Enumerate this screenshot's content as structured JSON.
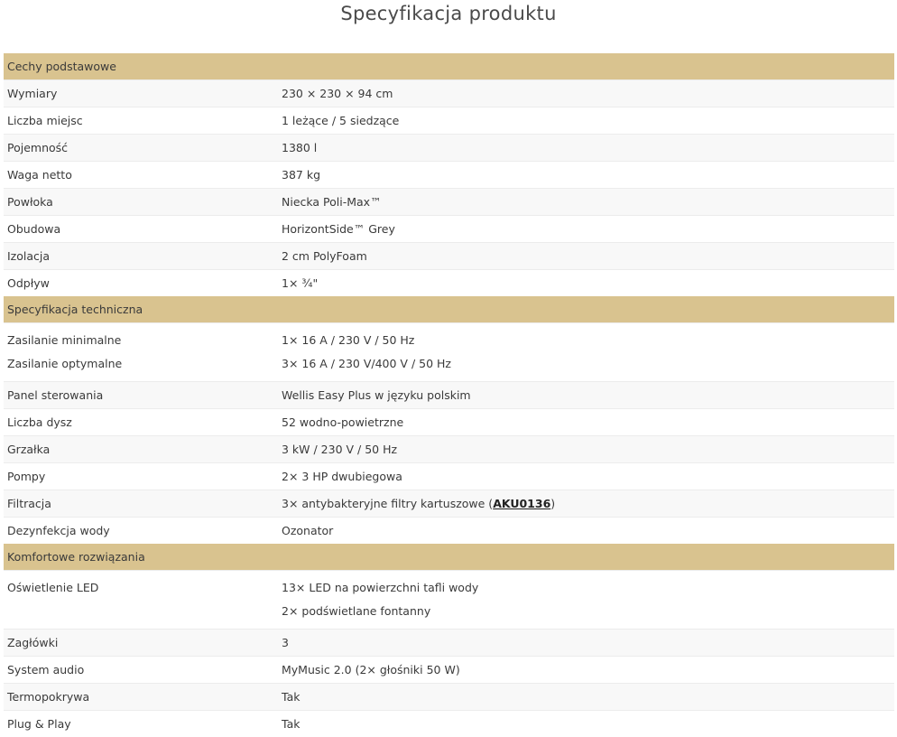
{
  "page_title": "Specyfikacja produktu",
  "sections": [
    {
      "title": "Cechy podstawowe",
      "rows": [
        {
          "label": "Wymiary",
          "value": "230 × 230 × 94 cm"
        },
        {
          "label": "Liczba miejsc",
          "value": "1 leżące / 5 siedzące"
        },
        {
          "label": "Pojemność",
          "value": "1380 l"
        },
        {
          "label": "Waga netto",
          "value": "387 kg"
        },
        {
          "label": "Powłoka",
          "value": "Niecka Poli-Max™"
        },
        {
          "label": "Obudowa",
          "value": "HorizontSide™ Grey"
        },
        {
          "label": "Izolacja",
          "value": "2 cm PolyFoam"
        },
        {
          "label": "Odpływ",
          "value": " 1× ¾\""
        }
      ]
    },
    {
      "title": "Specyfikacja techniczna",
      "rows": [
        {
          "label": "Zasilanie minimalne",
          "value": "1× 16 A / 230 V / 50 Hz"
        },
        {
          "label": "Zasilanie optymalne",
          "value": "3× 16 A / 230 V/400 V / 50 Hz"
        },
        {
          "label": "Panel sterowania",
          "value": "Wellis Easy Plus w języku polskim"
        },
        {
          "label": "Liczba dysz",
          "value": "52 wodno-powietrzne"
        },
        {
          "label": "Grzałka",
          "value": "3 kW / 230 V / 50 Hz"
        },
        {
          "label": "Pompy",
          "value": "2× 3 HP dwubiegowa"
        },
        {
          "label": "Filtracja",
          "value_prefix": "3× antybakteryjne filtry kartuszowe (",
          "link": "AKU0136",
          "value_suffix": ")"
        },
        {
          "label": "Dezynfekcja wody",
          "value": "Ozonator"
        }
      ]
    },
    {
      "title": "Komfortowe rozwiązania",
      "rows": [
        {
          "label": "Oświetlenie LED",
          "value_line1": "13× LED na powierzchni tafli wody",
          "value_line2": "2× podświetlane fontanny"
        },
        {
          "label": "Zagłówki",
          "value": "3"
        },
        {
          "label": "System audio",
          "value": "MyMusic 2.0 (2× głośniki 50 W)"
        },
        {
          "label": "Termopokrywa",
          "value": "Tak"
        },
        {
          "label": "Plug & Play",
          "value": "Tak"
        }
      ]
    }
  ]
}
